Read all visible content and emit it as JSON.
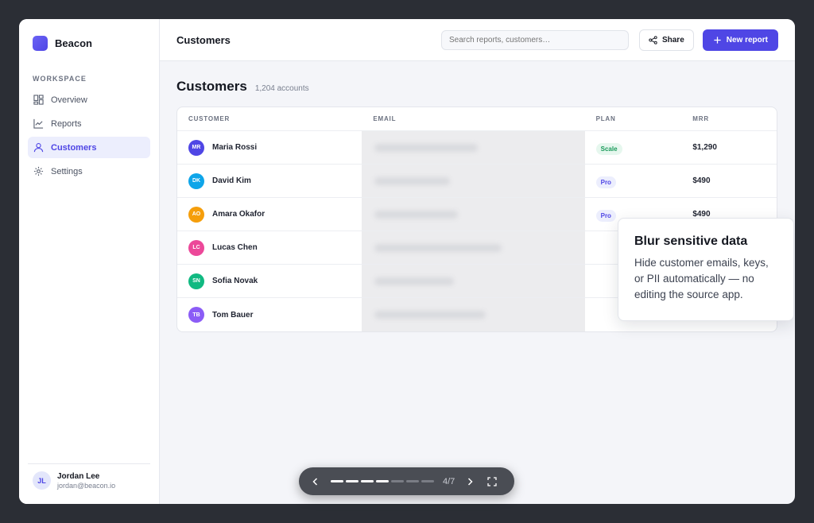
{
  "app": {
    "name": "Beacon",
    "accent": "#4f46e5"
  },
  "sidebar": {
    "section": "WORKSPACE",
    "items": [
      {
        "label": "Overview",
        "icon": "grid-icon",
        "active": false
      },
      {
        "label": "Reports",
        "icon": "chart-line-icon",
        "active": false
      },
      {
        "label": "Customers",
        "icon": "user-icon",
        "active": true
      },
      {
        "label": "Settings",
        "icon": "gear-icon",
        "active": false
      }
    ],
    "user": {
      "initials": "JL",
      "name": "Jordan Lee",
      "email": "jordan@beacon.io"
    }
  },
  "header": {
    "title": "Customers",
    "search_placeholder": "Search reports, customers…",
    "share_label": "Share",
    "new_label": "New report"
  },
  "page": {
    "title": "Customers",
    "count": "1,204 accounts"
  },
  "table": {
    "columns": [
      "CUSTOMER",
      "EMAIL",
      "PLAN",
      "MRR"
    ],
    "rows": [
      {
        "initials": "MR",
        "name": "Maria Rossi",
        "avatar_color": "#4f46e5",
        "plan": "Scale",
        "plan_style": "scale",
        "mrr": "$1,290"
      },
      {
        "initials": "DK",
        "name": "David Kim",
        "avatar_color": "#0ea5e9",
        "plan": "Pro",
        "plan_style": "pro",
        "mrr": "$490"
      },
      {
        "initials": "AO",
        "name": "Amara Okafor",
        "avatar_color": "#f59e0b",
        "plan": "Pro",
        "plan_style": "pro",
        "mrr": "$490"
      },
      {
        "initials": "LC",
        "name": "Lucas Chen",
        "avatar_color": "#ec4899",
        "plan": "",
        "plan_style": "",
        "mrr": "$0"
      },
      {
        "initials": "SN",
        "name": "Sofia Novak",
        "avatar_color": "#10b981",
        "plan": "",
        "plan_style": "",
        "mrr": "$1,290"
      },
      {
        "initials": "TB",
        "name": "Tom Bauer",
        "avatar_color": "#8b5cf6",
        "plan": "",
        "plan_style": "",
        "mrr": "$490"
      }
    ]
  },
  "callout": {
    "title": "Blur sensitive data",
    "body": "Hide customer emails, keys, or PII automatically — no editing the source app."
  },
  "player": {
    "counter": "4/7",
    "current": 4,
    "total": 7
  }
}
